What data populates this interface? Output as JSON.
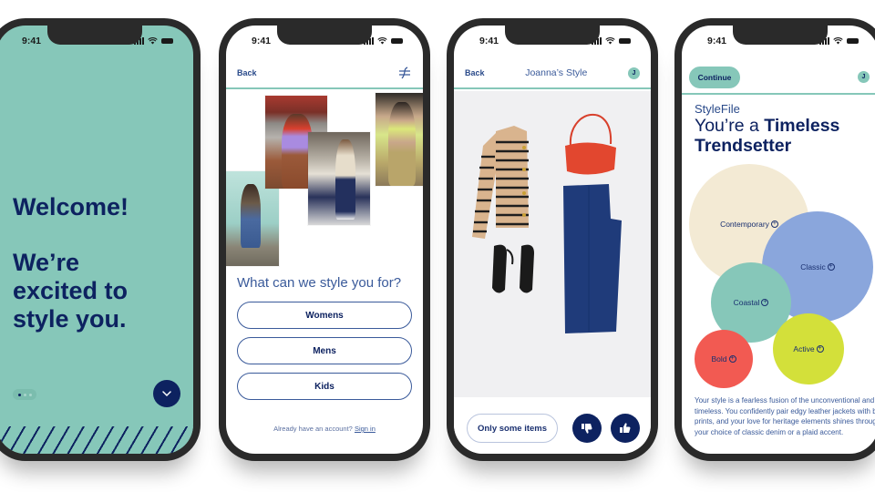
{
  "status_bar": {
    "time": "9:41"
  },
  "colors": {
    "navy": "#0d2260",
    "teal": "#86c7b9",
    "cream": "#f3ead4",
    "periwinkle": "#8aa6dc",
    "coral": "#f25a52",
    "lime": "#d3e03a"
  },
  "screen1": {
    "welcome": "Welcome!",
    "line1": "We’re",
    "line2": "excited to",
    "line3": "style you.",
    "pagination": {
      "total": 3,
      "active": 1
    },
    "next_icon": "chevron-down-icon"
  },
  "screen2": {
    "back_label": "Back",
    "logo_icon": "stylefile-logo-icon",
    "question": "What can we style you for?",
    "options": [
      "Womens",
      "Mens",
      "Kids"
    ],
    "account_prompt": "Already have an account?",
    "signin_link": "Sign in"
  },
  "screen3": {
    "back_label": "Back",
    "title": "Joanna’s Style",
    "avatar_initial": "J",
    "outfit_items": [
      "striped cardigan",
      "red crossbody bag",
      "dark wash jeans",
      "black mary jane flats"
    ],
    "partial_label": "Only some items",
    "dislike_icon": "thumbs-down-icon",
    "like_icon": "thumbs-up-icon"
  },
  "screen4": {
    "continue_label": "Continue",
    "avatar_initial": "J",
    "brand": "StyleFile",
    "headline_prefix": "You’re a ",
    "headline_bold1": "Timeless",
    "headline_bold2": "Trendsetter",
    "bubbles": [
      {
        "label": "Contemporary",
        "color": "#f3ead4"
      },
      {
        "label": "Classic",
        "color": "#8aa6dc"
      },
      {
        "label": "Coastal",
        "color": "#86c7b9"
      },
      {
        "label": "Bold",
        "color": "#f25a52"
      },
      {
        "label": "Active",
        "color": "#d3e03a"
      }
    ],
    "description": "Your style is a fearless fusion of the unconventional and the timeless. You confidently pair edgy leather jackets with bold prints, and your love for heritage elements shines through in your choice of classic denim or a plaid accent."
  }
}
